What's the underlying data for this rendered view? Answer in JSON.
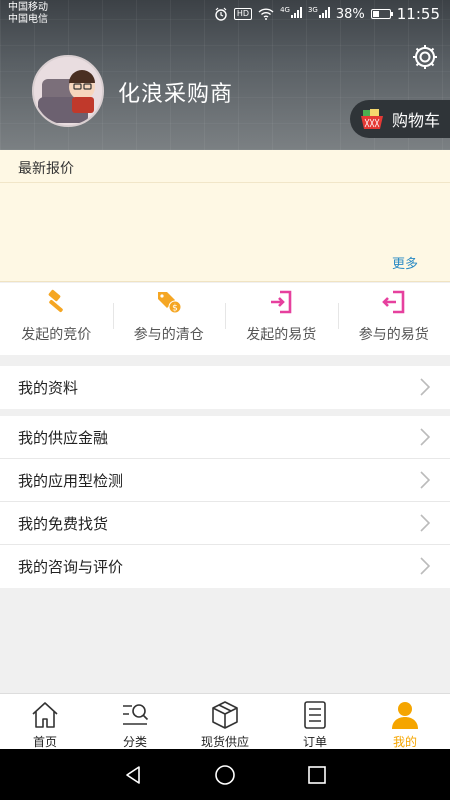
{
  "status_bar": {
    "carrier_1": "中国移动",
    "carrier_2": "中国电信",
    "network_1": "4G",
    "network_2": "3G",
    "battery": "38%",
    "time": "11:55",
    "hd_badge": "HD"
  },
  "profile": {
    "username": "化浪采购商",
    "cart_label": "购物车",
    "settings_icon": "gear-icon"
  },
  "quotes": {
    "title": "最新报价",
    "more": "更多"
  },
  "shortcuts": [
    {
      "label": "发起的竞价",
      "icon": "gavel-icon",
      "color": "#f5a623"
    },
    {
      "label": "参与的清仓",
      "icon": "price-tag-icon",
      "color": "#f5a623"
    },
    {
      "label": "发起的易货",
      "icon": "enter-icon",
      "color": "#e6409e"
    },
    {
      "label": "参与的易货",
      "icon": "enter-icon",
      "color": "#e6409e"
    }
  ],
  "menu_group_1": [
    {
      "label": "我的资料"
    }
  ],
  "menu_group_2": [
    {
      "label": "我的供应金融"
    },
    {
      "label": "我的应用型检测"
    },
    {
      "label": "我的免费找货"
    },
    {
      "label": "我的咨询与评价"
    }
  ],
  "bottom_nav": [
    {
      "label": "首页",
      "icon": "home-icon"
    },
    {
      "label": "分类",
      "icon": "category-search-icon"
    },
    {
      "label": "现货供应",
      "icon": "box-icon"
    },
    {
      "label": "订单",
      "icon": "order-list-icon"
    },
    {
      "label": "我的",
      "icon": "user-icon",
      "active": true
    }
  ],
  "colors": {
    "accent": "#f5a500",
    "link": "#2a8ac4",
    "quotes_bg": "#fef8e4"
  }
}
